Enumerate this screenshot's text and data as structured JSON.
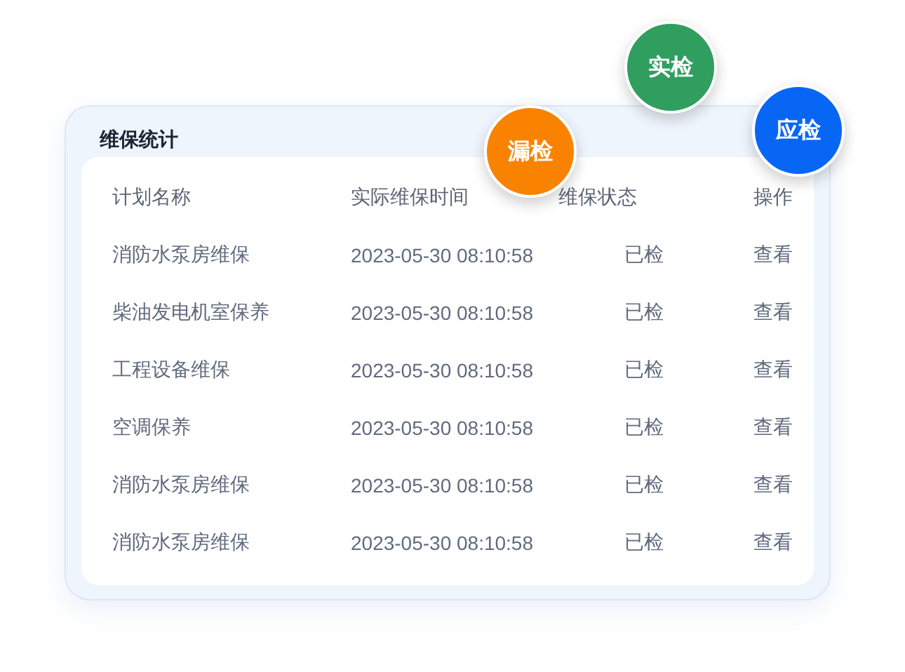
{
  "card": {
    "title": "维保统计"
  },
  "badges": [
    {
      "label": "实检",
      "color": "#2f9e5f"
    },
    {
      "label": "漏检",
      "color": "#f98300"
    },
    {
      "label": "应检",
      "color": "#0866f5"
    }
  ],
  "table": {
    "columns": [
      "计划名称",
      "实际维保时间",
      "维保状态",
      "操作"
    ],
    "rows": [
      {
        "name": "消防水泵房维保",
        "time": "2023-05-30 08:10:58",
        "status": "已检",
        "action": "查看"
      },
      {
        "name": "柴油发电机室保养",
        "time": "2023-05-30 08:10:58",
        "status": "已检",
        "action": "查看"
      },
      {
        "name": "工程设备维保",
        "time": "2023-05-30 08:10:58",
        "status": "已检",
        "action": "查看"
      },
      {
        "name": "空调保养",
        "time": "2023-05-30 08:10:58",
        "status": "已检",
        "action": "查看"
      },
      {
        "name": "消防水泵房维保",
        "time": "2023-05-30 08:10:58",
        "status": "已检",
        "action": "查看"
      },
      {
        "name": "消防水泵房维保",
        "time": "2023-05-30 08:10:58",
        "status": "已检",
        "action": "查看"
      }
    ]
  }
}
